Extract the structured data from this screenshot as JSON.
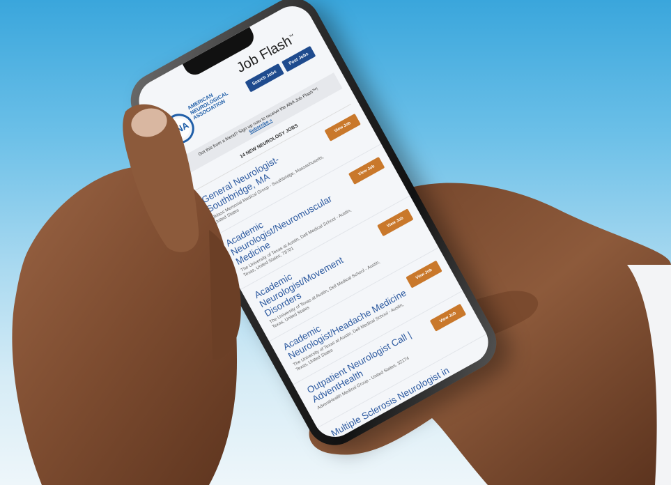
{
  "email": {
    "header": {
      "logo_mark": "ANA",
      "org_name": "American Neurological Association",
      "title": "Job Flash",
      "title_mark": "™",
      "search_jobs_label": "Search Jobs",
      "post_jobs_label": "Post Jobs"
    },
    "friend_bar": {
      "text": "Got this from a friend? Sign up now to receive the ANA Job Flash™!",
      "subscribe_label": "Subscribe »"
    },
    "jobs_heading": "14 NEW NEUROLOGY JOBS",
    "view_job_label": "View Job",
    "jobs": [
      {
        "title": "General Neurologist-Southbridge, MA",
        "employer": "UMass Memorial Medical Group - Southbridge, Massachusetts, United States"
      },
      {
        "title": "Academic Neurologist/Neuromuscular Medicine",
        "employer": "The University of Texas at Austin, Dell Medical School - Austin, Texas, United States, 78701"
      },
      {
        "title": "Academic Neurologist/Movement Disorders",
        "employer": "The University of Texas at Austin, Dell Medical School - Austin, Texas, United States"
      },
      {
        "title": "Academic Neurologist/Headache Medicine",
        "employer": "The University of Texas at Austin, Dell Medical School - Austin, Texas, United States"
      },
      {
        "title": "Outpatient Neurologist Call | AdventHealth",
        "employer": "AdventHealth Medical Group - United States, 32174"
      },
      {
        "title": "Multiple Sclerosis Neurologist in",
        "employer": ""
      }
    ]
  },
  "colors": {
    "background_top": "#3aa6dc",
    "background_bottom": "#eef6fa",
    "brand_blue": "#1f4b8e",
    "link_blue": "#2d5aa0",
    "view_button": "#c9782b",
    "skin": "#8a5a3c"
  }
}
